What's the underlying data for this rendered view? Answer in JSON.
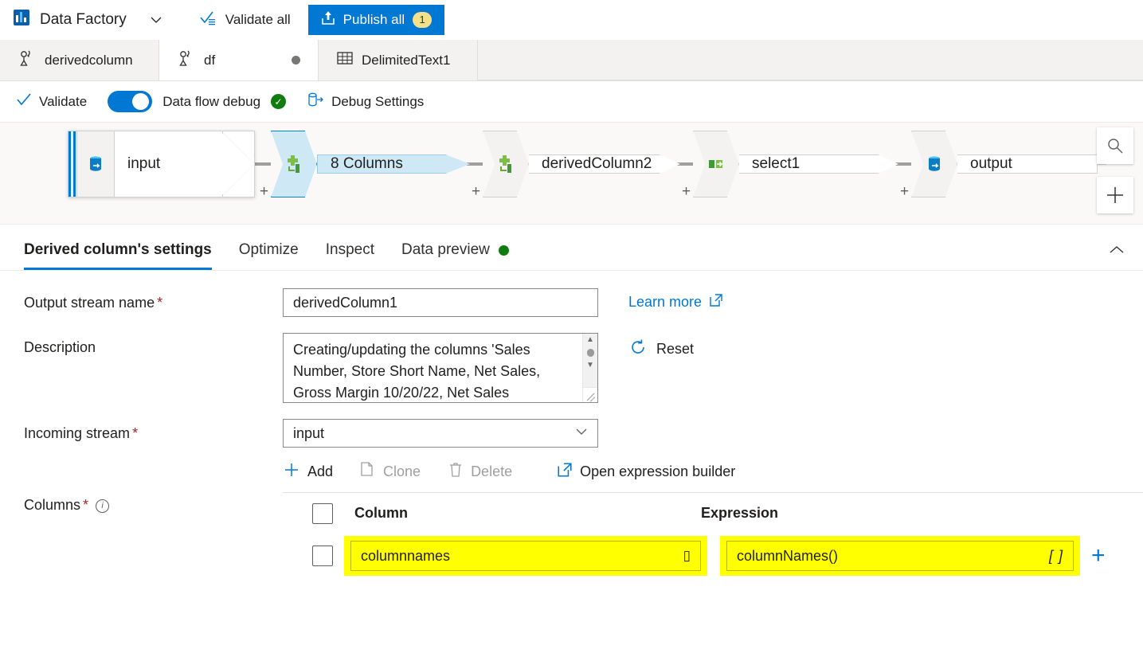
{
  "topbar": {
    "brand_icon": "data-factory-icon",
    "brand": "Data Factory",
    "chevron_icon": "chevron-down-icon",
    "validate_all_icon": "validate-all-icon",
    "validate_all": "Validate all",
    "publish_icon": "publish-upload-icon",
    "publish": "Publish all",
    "publish_count": "1",
    "accent": "#0078d4",
    "badge_color": "#f5e08c"
  },
  "tabs": [
    {
      "label": "derivedcolumn",
      "icon": "data-flow-icon",
      "active": false,
      "dirty": false
    },
    {
      "label": "df",
      "icon": "data-flow-icon",
      "active": true,
      "dirty": true
    },
    {
      "label": "DelimitedText1",
      "icon": "dataset-table-icon",
      "active": false,
      "dirty": false
    }
  ],
  "commandbar": {
    "validate_icon": "checkmark-icon",
    "validate": "Validate",
    "debug_toggle_on": true,
    "debug_label": "Data flow debug",
    "debug_status_icon": "green-check-icon",
    "debug_settings_icon": "debug-settings-icon",
    "debug_settings": "Debug Settings"
  },
  "canvas": {
    "nodes": [
      {
        "label": "input",
        "icon": "source-database-icon",
        "type": "source",
        "selected": false
      },
      {
        "label": "8 Columns",
        "icon": "derived-column-icon",
        "type": "transform",
        "selected": true
      },
      {
        "label": "derivedColumn2",
        "icon": "derived-column-icon",
        "type": "transform",
        "selected": false
      },
      {
        "label": "select1",
        "icon": "select-icon",
        "type": "transform",
        "selected": false
      },
      {
        "label": "output",
        "icon": "sink-database-icon",
        "type": "sink",
        "selected": false
      }
    ],
    "connector_plus": "+",
    "search_icon": "search-icon",
    "zoom_in_icon": "plus-icon",
    "selected_fill": "#cfe8f5"
  },
  "panel": {
    "tabs": [
      {
        "label": "Derived column's settings",
        "active": true,
        "dot": false
      },
      {
        "label": "Optimize",
        "active": false,
        "dot": false
      },
      {
        "label": "Inspect",
        "active": false,
        "dot": false
      },
      {
        "label": "Data preview",
        "active": false,
        "dot": true
      }
    ],
    "collapse_icon": "chevron-up-icon",
    "dot_color": "#107c10"
  },
  "form": {
    "output_stream_label": "Output stream name",
    "output_stream_value": "derivedColumn1",
    "learn_more": "Learn more",
    "learn_more_icon": "external-link-icon",
    "description_label": "Description",
    "description_value": "Creating/updating the columns 'Sales Number, Store Short Name, Net Sales, Gross Margin 10/20/22, Net Sales",
    "reset_icon": "refresh-icon",
    "reset": "Reset",
    "incoming_stream_label": "Incoming stream",
    "incoming_stream_value": "input",
    "incoming_stream_chevron": "chevron-down-icon",
    "columns_label": "Columns",
    "columns_info_icon": "info-icon",
    "required_mark": "*"
  },
  "grid": {
    "toolbar": [
      {
        "label": "Add",
        "icon": "plus-icon",
        "enabled": true
      },
      {
        "label": "Clone",
        "icon": "copy-icon",
        "enabled": false
      },
      {
        "label": "Delete",
        "icon": "trash-icon",
        "enabled": false
      },
      {
        "label": "Open expression builder",
        "icon": "external-link-icon",
        "enabled": true
      }
    ],
    "headers": {
      "column": "Column",
      "expression": "Expression"
    },
    "rows": [
      {
        "column": "columnnames",
        "column_glyph": "▯",
        "expression": "columnNames()",
        "expression_glyph": "[ ]",
        "highlight": "#ffff00"
      }
    ],
    "row_add_icon": "plus-icon"
  }
}
